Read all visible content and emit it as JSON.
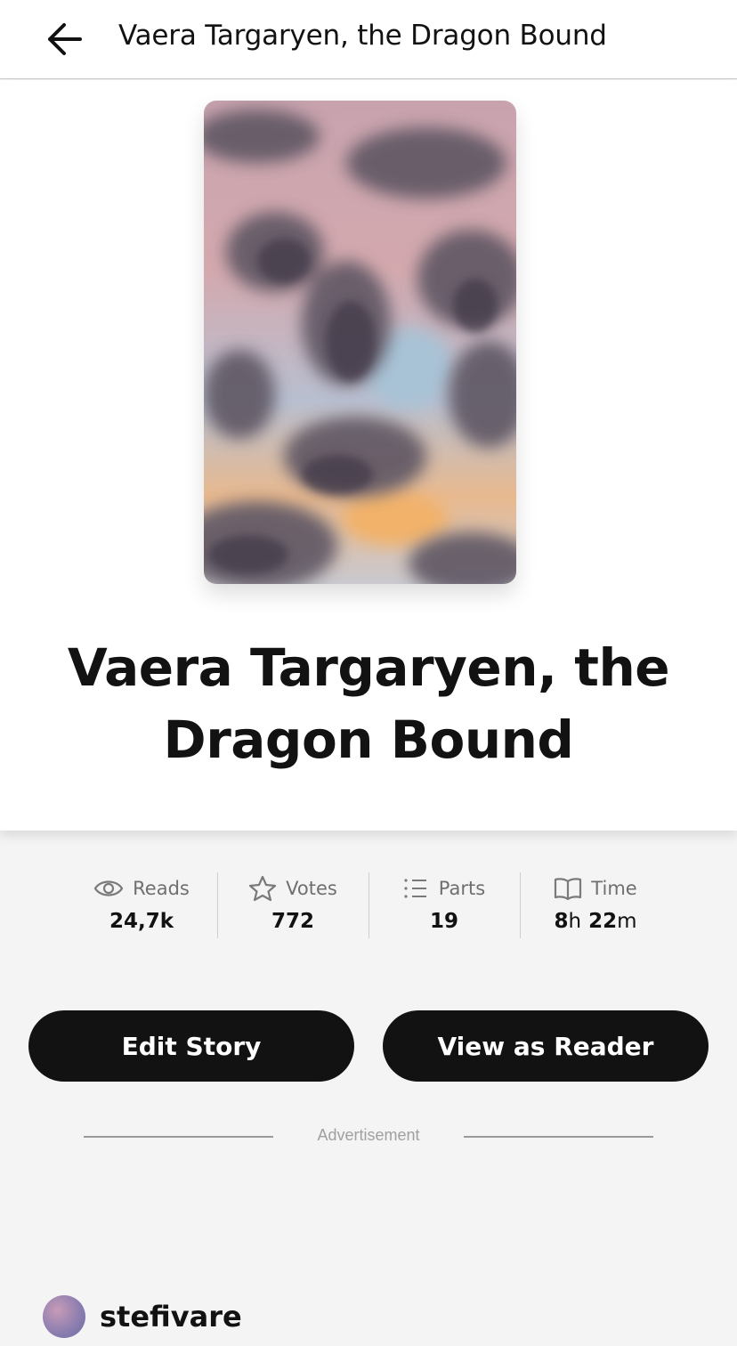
{
  "header": {
    "title": "Vaera Targaryen, the Dragon Bound",
    "back_icon": "arrow-left-icon"
  },
  "story": {
    "title": "Vaera Targaryen, the Dragon Bound",
    "cover_description": "pastel sky with dark clouds"
  },
  "stats": [
    {
      "icon": "eye-icon",
      "label": "Reads",
      "value": "24,7k"
    },
    {
      "icon": "star-icon",
      "label": "Votes",
      "value": "772"
    },
    {
      "icon": "list-icon",
      "label": "Parts",
      "value": "19"
    },
    {
      "icon": "book-icon",
      "label": "Time",
      "value_hours": "8",
      "hours_unit": "h",
      "value_minutes": "22",
      "minutes_unit": "m"
    }
  ],
  "actions": {
    "edit_label": "Edit Story",
    "view_label": "View as Reader"
  },
  "ad": {
    "label": "Advertisement"
  },
  "author": {
    "name": "stefivare"
  },
  "colors": {
    "button_bg": "#121212",
    "page_bg": "#f4f4f4",
    "muted_text": "#6f6f6f"
  }
}
